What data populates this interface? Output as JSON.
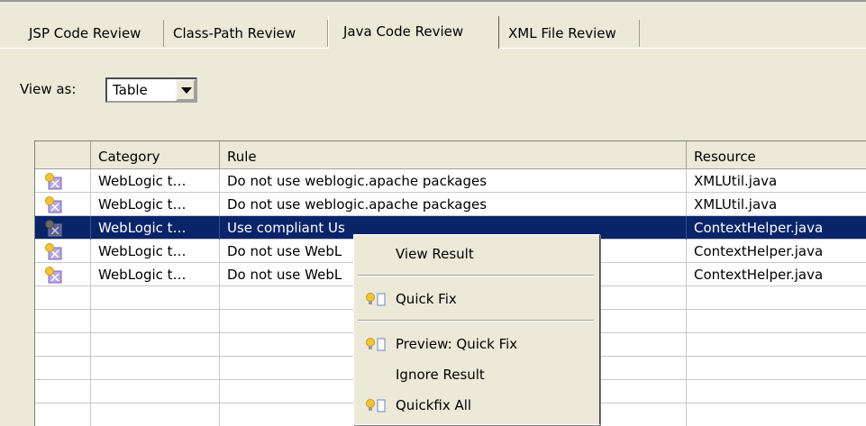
{
  "tabs": [
    {
      "label": "JSP Code Review",
      "active": false
    },
    {
      "label": "Class-Path Review",
      "active": false
    },
    {
      "label": "Java Code Review",
      "active": true
    },
    {
      "label": "XML File Review",
      "active": false
    }
  ],
  "view_as": {
    "label": "View as:",
    "value": "Table"
  },
  "table": {
    "columns": [
      "",
      "Category",
      "Rule",
      "Resource"
    ],
    "rows": [
      {
        "icon": "lightbulb-warning-icon",
        "category": "WebLogic t…",
        "rule": "Do not use weblogic.apache packages",
        "resource": "XMLUtil.java",
        "selected": false
      },
      {
        "icon": "lightbulb-warning-icon",
        "category": "WebLogic t…",
        "rule": "Do not use weblogic.apache packages",
        "resource": "XMLUtil.java",
        "selected": false
      },
      {
        "icon": "lightbulb-warning-icon",
        "category": "WebLogic t…",
        "rule": "Use compliant Us",
        "resource": "ContextHelper.java",
        "selected": true
      },
      {
        "icon": "lightbulb-warning-icon",
        "category": "WebLogic t…",
        "rule": "Do not use WebL",
        "resource": "ContextHelper.java",
        "selected": false
      },
      {
        "icon": "lightbulb-warning-icon",
        "category": "WebLogic t…",
        "rule": "Do not use WebL",
        "resource": "ContextHelper.java",
        "selected": false
      }
    ]
  },
  "context_menu": {
    "view_result": "View Result",
    "quick_fix": "Quick Fix",
    "preview_quick_fix": "Preview: Quick Fix",
    "ignore_result": "Ignore Result",
    "quickfix_all": "Quickfix All"
  },
  "colors": {
    "selection": "#0a246a",
    "background": "#ece9d8",
    "bulb": "#f5c33b"
  }
}
